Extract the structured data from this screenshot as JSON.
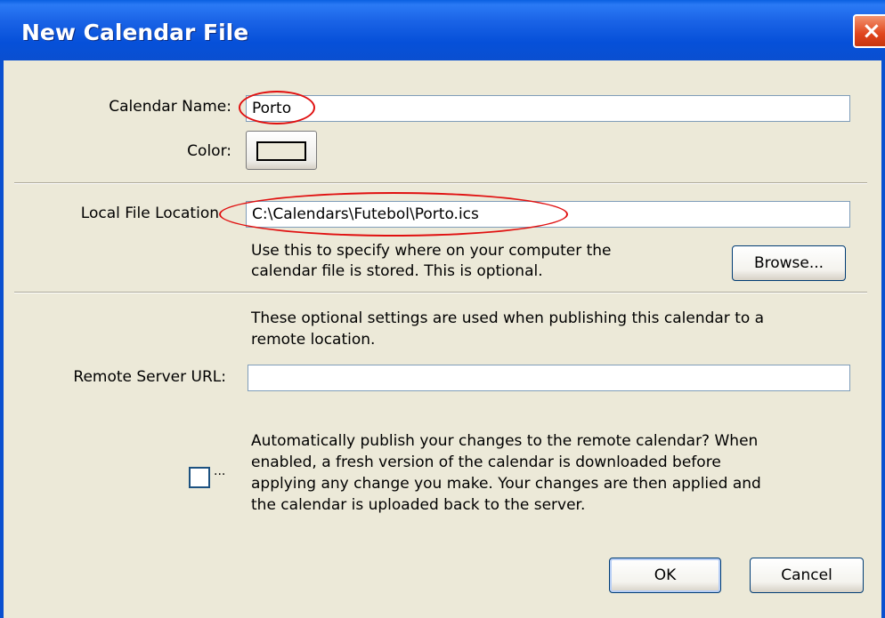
{
  "window": {
    "title": "New Calendar File",
    "close_symbol": "×"
  },
  "form": {
    "calendar_name_label": "Calendar Name:",
    "calendar_name_value": "Porto",
    "color_label": "Color:",
    "local_file_label": "Local File Location",
    "local_file_value": "C:\\Calendars\\Futebol\\Porto.ics",
    "local_file_help_line1": "Use this to specify where on your computer the",
    "local_file_help_line2": "calendar file is stored. This is optional.",
    "browse_label": "Browse...",
    "remote_help_line1": "These optional settings are used when publishing this calendar to a",
    "remote_help_line2": "remote location.",
    "remote_url_label": "Remote Server URL:",
    "remote_url_value": "",
    "auto_publish_ellipsis": "...",
    "auto_publish_line1": "Automatically publish your changes to the remote calendar? When",
    "auto_publish_line2": "enabled, a fresh version of the calendar is downloaded before",
    "auto_publish_line3": "applying any change you make. Your changes are then applied and",
    "auto_publish_line4": "the calendar is uploaded back to the server.",
    "auto_publish_checked": false
  },
  "buttons": {
    "ok": "OK",
    "cancel": "Cancel"
  },
  "colors": {
    "titlebar": "#0a5fe0",
    "dialog_bg": "#ece9d8",
    "annotation": "#e01010"
  }
}
